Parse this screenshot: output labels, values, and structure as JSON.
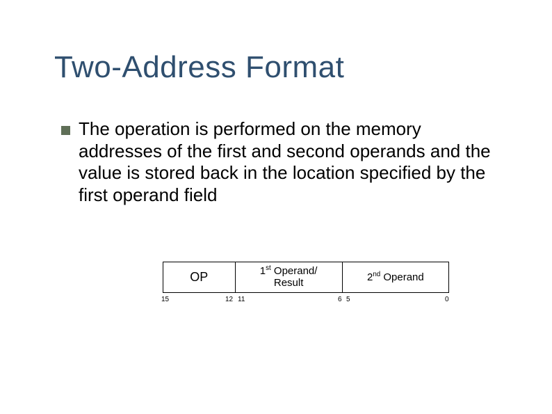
{
  "title": "Two-Address Format",
  "bullet": "The operation is performed on the memory addresses of the first and second operands and the value is stored back in the location specified by the first operand field",
  "fields": {
    "op": "OP",
    "operand1_pre": "1",
    "operand1_sup": "st",
    "operand1_post": " Operand/",
    "operand1_line2": "Result",
    "operand2_pre": "2",
    "operand2_sup": "nd",
    "operand2_post": " Operand"
  },
  "bits": {
    "b15": "15",
    "b12": "12",
    "b11": "11",
    "b6": "6",
    "b5": "5",
    "b0": "0"
  },
  "chart_data": {
    "type": "table",
    "title": "Two-Address instruction format bit layout",
    "fields": [
      {
        "name": "OP",
        "high_bit": 15,
        "low_bit": 12,
        "width": 4
      },
      {
        "name": "1st Operand/Result",
        "high_bit": 11,
        "low_bit": 6,
        "width": 6
      },
      {
        "name": "2nd Operand",
        "high_bit": 5,
        "low_bit": 0,
        "width": 6
      }
    ],
    "total_bits": 16
  }
}
